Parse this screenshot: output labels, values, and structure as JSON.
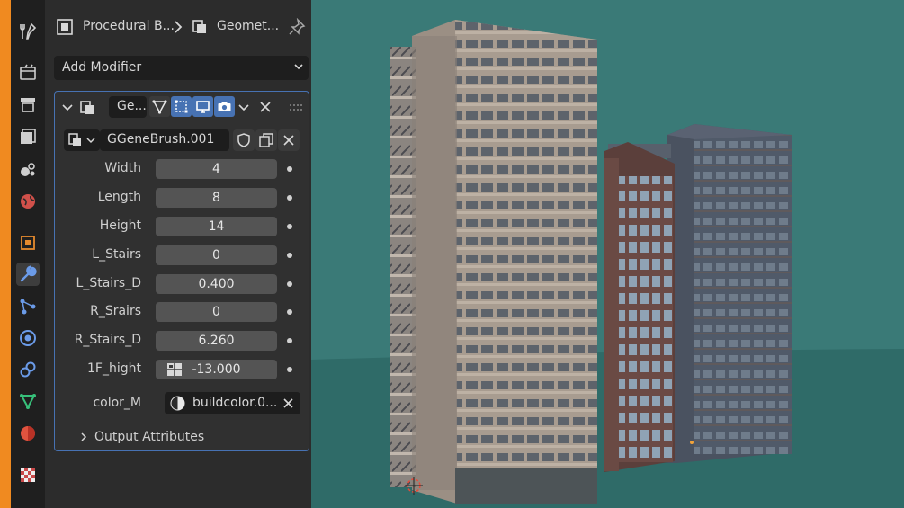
{
  "properties_tabs": [
    "tool-icon",
    "render-icon",
    "output-icon",
    "view-layer-icon",
    "scene-icon",
    "world-icon",
    "object-icon",
    "modifier-icon",
    "particles-icon",
    "physics-icon",
    "constraints-icon",
    "data-icon",
    "material-icon",
    "texture-icon"
  ],
  "breadcrumb": {
    "object_name": "Procedural B...",
    "modifier_name": "Geomet..."
  },
  "add_modifier_label": "Add Modifier",
  "modifier": {
    "short_name": "Ge...",
    "node_group": "GGeneBrush.001",
    "inputs": [
      {
        "label": "Width",
        "value": "4"
      },
      {
        "label": "Length",
        "value": "8"
      },
      {
        "label": "Height",
        "value": "14"
      },
      {
        "label": "L_Stairs",
        "value": "0"
      },
      {
        "label": "L_Stairs_D",
        "value": "0.400"
      },
      {
        "label": "R_Srairs",
        "value": "0"
      },
      {
        "label": "R_Stairs_D",
        "value": "6.260"
      },
      {
        "label": "1F_hight",
        "value": "-13.000"
      }
    ],
    "color_input": {
      "label": "color_M",
      "value": "buildcolor.0..."
    },
    "output_attributes_label": "Output Attributes"
  },
  "colors": {
    "accent_blue": "#4772b3",
    "sky_teal": "#3a7a77",
    "ground_teal": "#2f6b68",
    "editor_orange": "#f08a20"
  }
}
